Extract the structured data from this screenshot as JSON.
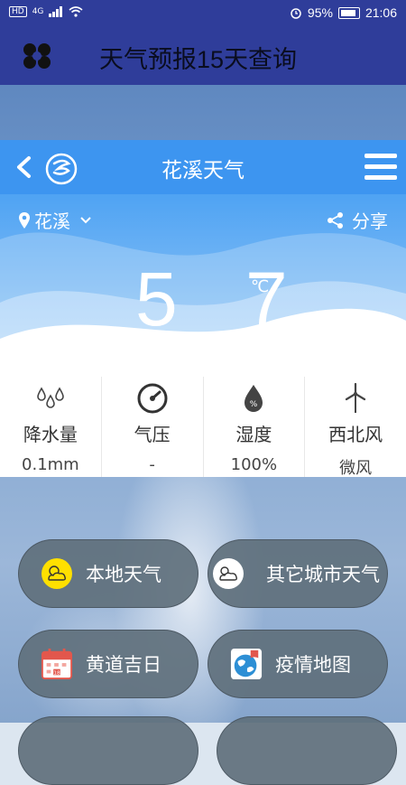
{
  "status_bar": {
    "left_badge": "HD",
    "signal": "4G",
    "battery": "95%",
    "time": "21:06"
  },
  "app_bar": {
    "title": "天气预报15天查询"
  },
  "card": {
    "title": "花溪天气",
    "location": "花溪",
    "share_label": "分享",
    "temperature": "5 7",
    "temp_unit": "℃",
    "stats": [
      {
        "label": "降水量",
        "value": "0.1mm"
      },
      {
        "label": "气压",
        "value": "-"
      },
      {
        "label": "湿度",
        "value": "100%"
      },
      {
        "label": "西北风",
        "value": "微风"
      }
    ]
  },
  "buttons": {
    "local": "本地天气",
    "other": "其它城市天气",
    "calendar": "黄道吉日",
    "epidemic": "疫情地图"
  },
  "icons": {
    "back": "chevron-left-icon",
    "brand": "logo-icon",
    "menu": "menu-icon",
    "location": "location-pin-icon",
    "share": "share-icon"
  },
  "colors": {
    "status_bar": "#2f3d9a",
    "card_header": "#3d95f0",
    "button_bg": "#60707c"
  }
}
